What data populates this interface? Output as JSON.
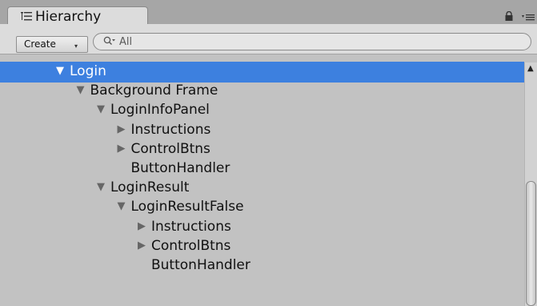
{
  "window": {
    "tab_title": "Hierarchy",
    "tab_icon": "hierarchy-list-icon",
    "lock_icon": "lock-icon",
    "menu_icon": "panel-menu-icon"
  },
  "toolbar": {
    "create_label": "Create",
    "create_caret": "▾",
    "search_placeholder": "All",
    "search_value": "",
    "search_icon": "search-icon"
  },
  "hierarchy": {
    "items": [
      {
        "label": "Login",
        "expanded": true,
        "has_children": true,
        "depth": 0,
        "selected": true
      },
      {
        "label": "Background Frame",
        "expanded": true,
        "has_children": true,
        "depth": 1,
        "selected": false
      },
      {
        "label": "LoginInfoPanel",
        "expanded": true,
        "has_children": true,
        "depth": 2,
        "selected": false
      },
      {
        "label": "Instructions",
        "expanded": false,
        "has_children": true,
        "depth": 3,
        "selected": false
      },
      {
        "label": "ControlBtns",
        "expanded": false,
        "has_children": true,
        "depth": 3,
        "selected": false
      },
      {
        "label": "ButtonHandler",
        "expanded": false,
        "has_children": false,
        "depth": 3,
        "selected": false
      },
      {
        "label": "LoginResult",
        "expanded": true,
        "has_children": true,
        "depth": 2,
        "selected": false
      },
      {
        "label": "LoginResultFalse",
        "expanded": true,
        "has_children": true,
        "depth": 3,
        "selected": false
      },
      {
        "label": "Instructions",
        "expanded": false,
        "has_children": true,
        "depth": 4,
        "selected": false
      },
      {
        "label": "ControlBtns",
        "expanded": false,
        "has_children": true,
        "depth": 4,
        "selected": false
      },
      {
        "label": "ButtonHandler",
        "expanded": false,
        "has_children": false,
        "depth": 4,
        "selected": false
      }
    ]
  },
  "scrollbar": {
    "up_arrow": "▲"
  },
  "colors": {
    "selection": "#3d80df",
    "background": "#c2c2c2",
    "toolbar": "#dcdcdc"
  }
}
